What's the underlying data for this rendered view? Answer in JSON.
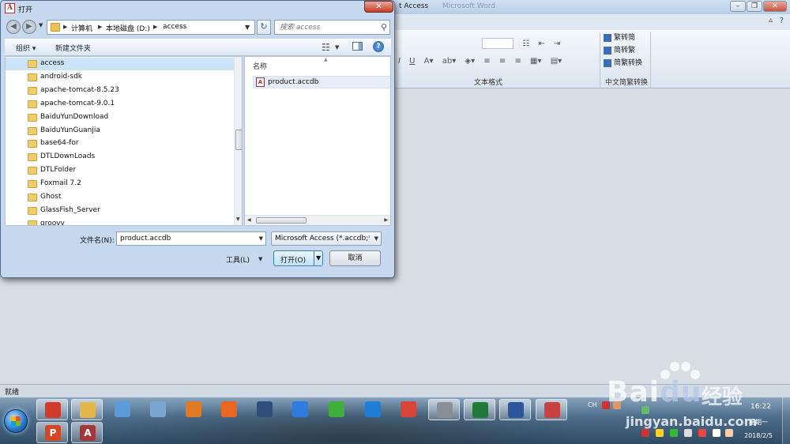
{
  "background_app": {
    "title": "t Access",
    "title_faded": "Microsoft Word",
    "status_text": "就绪",
    "ribbon": {
      "text_format_group_label": "文本格式",
      "convert_group_label": "中文简繁转换",
      "convert_items": [
        "繁转简",
        "简转繁",
        "简繁转换"
      ]
    }
  },
  "dialog": {
    "title": "打开",
    "app_icon_letter": "A",
    "breadcrumb": [
      "计算机",
      "本地磁盘 (D:)",
      "access"
    ],
    "search_placeholder": "搜索 access",
    "toolbar": {
      "organize": "组织",
      "new_folder": "新建文件夹"
    },
    "folders": [
      "access",
      "android-sdk",
      "apache-tomcat-8.5.23",
      "apache-tomcat-9.0.1",
      "BaiduYunDownload",
      "BaiduYunGuanjia",
      "base64-for",
      "DTLDownLoads",
      "DTLFolder",
      "Foxmail 7.2",
      "Ghost",
      "GlassFish_Server",
      "groovy"
    ],
    "selected_folder_index": 0,
    "file_list": {
      "column_name": "名称",
      "files": [
        "product.accdb"
      ]
    },
    "filename_label": "文件名(N):",
    "filename_value": "product.accdb",
    "filetype_value": "Microsoft Access (*.accdb;*.m",
    "tools_label": "工具(L)",
    "open_label": "打开(O)",
    "cancel_label": "取消"
  },
  "taskbar": {
    "apps": [
      {
        "icon": "browser-360-icon",
        "color": "#d23a2a"
      },
      {
        "icon": "file-explorer-icon",
        "color": "#e2b64a"
      },
      {
        "icon": "paint-icon",
        "color": "#5a9bd8"
      },
      {
        "icon": "notepad-icon",
        "color": "#7aa6cf"
      },
      {
        "icon": "search-tool-icon",
        "color": "#e07a22"
      },
      {
        "icon": "firefox-icon",
        "color": "#e8661f"
      },
      {
        "icon": "meeting-icon",
        "color": "#2d4f7a"
      },
      {
        "icon": "blue-note-icon",
        "color": "#2f7ce0"
      },
      {
        "icon": "green-sync-icon",
        "color": "#3fae3a"
      },
      {
        "icon": "ie-icon",
        "color": "#1e7fd8"
      },
      {
        "icon": "chrome-icon",
        "color": "#d64535"
      },
      {
        "icon": "calculator-icon",
        "color": "#8a8f96"
      },
      {
        "icon": "excel-icon",
        "color": "#1f7a3a"
      },
      {
        "icon": "word-icon",
        "color": "#2b579a"
      },
      {
        "icon": "paint-tool-icon",
        "color": "#c94141"
      }
    ],
    "second_row": [
      {
        "icon": "powerpoint-icon",
        "letter": "P",
        "color": "#d24726"
      },
      {
        "icon": "access-icon",
        "letter": "A",
        "color": "#a4373a"
      }
    ],
    "tray_lang": "CH",
    "clock_time": "16:22",
    "clock_day": "星期一",
    "clock_date": "2018/2/5"
  },
  "watermark": {
    "brand": "Bai",
    "brand2": "du",
    "cn": "经验",
    "url": "jingyan.baidu.com"
  }
}
